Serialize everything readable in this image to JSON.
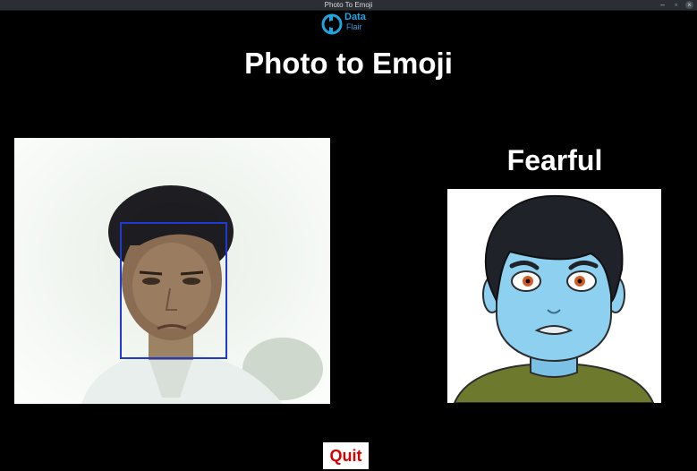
{
  "window": {
    "title": "Photo To Emoji"
  },
  "logo": {
    "line1": "Data",
    "line2": "Flair"
  },
  "heading": "Photo to Emoji",
  "emotion": {
    "label": "Fearful"
  },
  "buttons": {
    "quit": "Quit"
  },
  "colors": {
    "background": "#000000",
    "heading_text": "#ffffff",
    "quit_text": "#d60000",
    "face_box": "#1e3ad0",
    "brand": "#1fa5e0",
    "emoji_skin": "#8ed0f0",
    "emoji_shirt": "#6d7a2e"
  },
  "icons": [
    "dataflair-logo-icon",
    "minimize-icon",
    "restore-icon",
    "close-icon"
  ]
}
